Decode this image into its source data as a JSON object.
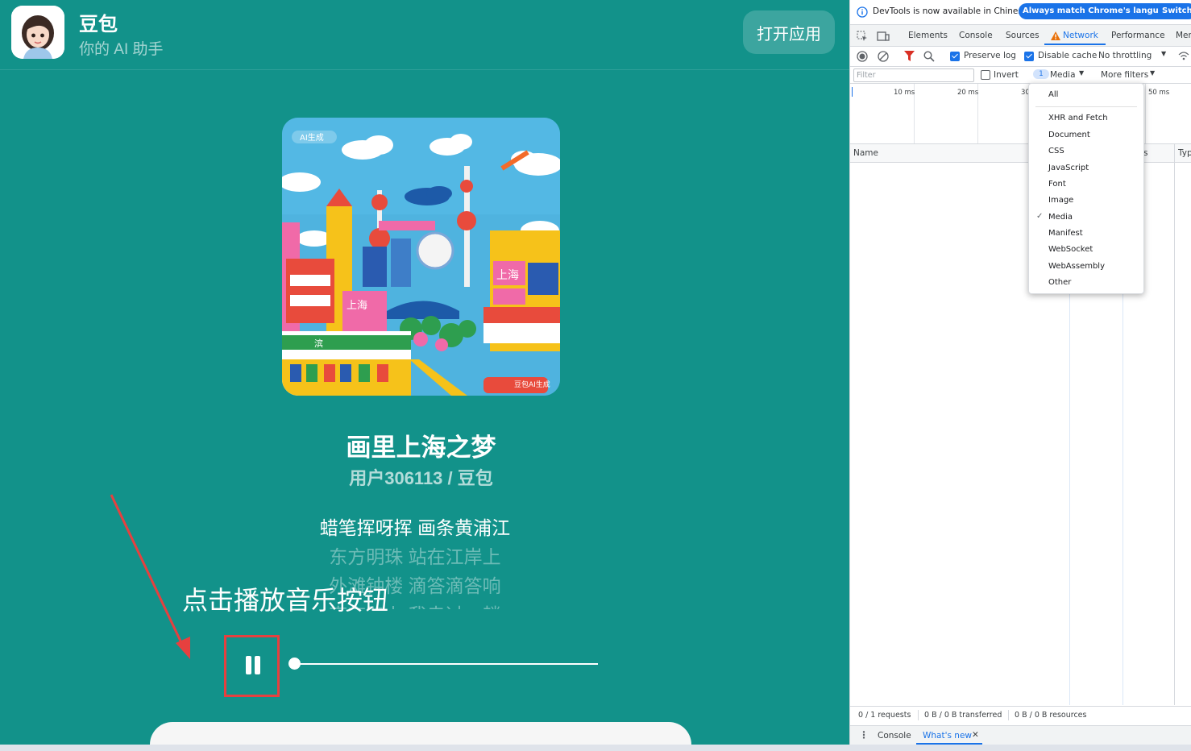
{
  "app": {
    "name": "豆包",
    "tagline": "你的 AI 助手",
    "open_button": "打开应用"
  },
  "song": {
    "title": "画里上海之梦",
    "artist": "用户306113 / 豆包",
    "cover_badge": "AI生成",
    "cover_watermark": "豆包AI生成",
    "cover_signs": [
      "上海",
      "上海",
      "上海",
      "滨"
    ]
  },
  "lyrics": [
    "蜡笔挥呀挥 画条黄浦江",
    "东方明珠 站在江岸上",
    "外滩钟楼 滴答滴答响",
    "南京路上 我走过一趟"
  ],
  "player": {
    "state": "playing",
    "progress": 0.0
  },
  "annotation": {
    "text": "点击播放音乐按钮",
    "color": "#e6403f"
  },
  "devtools": {
    "notice": "DevTools is now available in Chinese!",
    "notice_btn1": "Always match Chrome's language",
    "notice_btn2": "Switch",
    "tabs": [
      "Elements",
      "Console",
      "Sources",
      "Network",
      "Performance",
      "Mer"
    ],
    "active_tab": "Network",
    "preserve_log": "Preserve log",
    "disable_cache": "Disable cache",
    "throttling": "No throttling",
    "filter_placeholder": "Filter",
    "invert": "Invert",
    "media_count": "1",
    "media_filter": "Media",
    "more_filters": "More filters",
    "ticks": [
      "10 ms",
      "20 ms",
      "30",
      "50 ms"
    ],
    "columns": [
      "Name",
      "s",
      "Typ"
    ],
    "dropdown_items": [
      "All",
      "XHR and Fetch",
      "Document",
      "CSS",
      "JavaScript",
      "Font",
      "Image",
      "Media",
      "Manifest",
      "WebSocket",
      "WebAssembly",
      "Other"
    ],
    "dropdown_checked": "Media",
    "status": {
      "requests": "0 / 1 requests",
      "transferred": "0 B / 0 B transferred",
      "resources": "0 B / 0 B resources"
    },
    "drawer_tabs": [
      "Console",
      "What's new"
    ],
    "accent": "#1a73e8"
  }
}
